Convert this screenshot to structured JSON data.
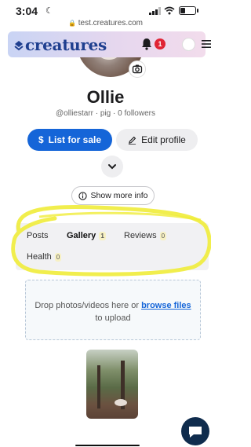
{
  "status_bar": {
    "time": "3:04",
    "url": "test.creatures.com"
  },
  "header": {
    "logo": "creatures",
    "notification_count": "1"
  },
  "profile": {
    "name": "Ollie",
    "handle": "@olliestarr",
    "species": "pig",
    "followers": "0 followers",
    "meta_separator": "·"
  },
  "actions": {
    "list_for_sale": "List for sale",
    "edit_profile": "Edit profile",
    "show_more_info": "Show more info"
  },
  "tabs": [
    {
      "label": "Posts",
      "count": ""
    },
    {
      "label": "Gallery",
      "count": "1"
    },
    {
      "label": "Reviews",
      "count": "0"
    },
    {
      "label": "Health",
      "count": "0"
    }
  ],
  "active_tab": "Gallery",
  "upload": {
    "prompt_before": "Drop photos/videos here or",
    "browse_link": "browse files",
    "prompt_after": "to upload"
  },
  "colors": {
    "primary": "#1565d8",
    "badge": "#e02434",
    "logo": "#1f3f8f",
    "highlight": "#f0ec3a",
    "chat_button": "#0f2c4d"
  },
  "icons": [
    "moon-icon",
    "lock-icon",
    "signal-icon",
    "wifi-icon",
    "battery-icon",
    "bell-icon",
    "menu-icon",
    "camera-icon",
    "dollar-icon",
    "edit-icon",
    "chevron-down-icon",
    "info-icon",
    "chat-icon"
  ]
}
